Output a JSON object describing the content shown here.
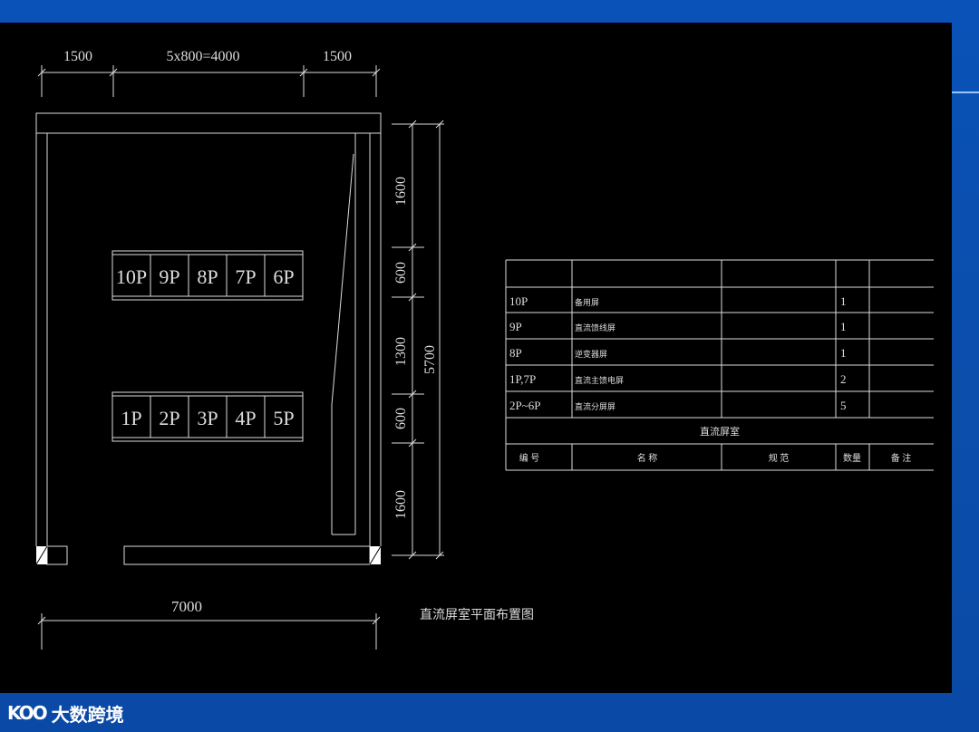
{
  "drawing": {
    "top_dims": [
      "1500",
      "5x800=4000",
      "1500"
    ],
    "right_dims": [
      "1600",
      "600",
      "1300",
      "600",
      "1600"
    ],
    "total_height": "5700",
    "total_width": "7000",
    "row_top": [
      "10P",
      "9P",
      "8P",
      "7P",
      "6P"
    ],
    "row_bottom": [
      "1P",
      "2P",
      "3P",
      "4P",
      "5P"
    ],
    "caption": "直流屏室平面布置图"
  },
  "table": {
    "rows": [
      {
        "id": "10P",
        "name": "备用屏",
        "spec": "",
        "qty": "1",
        "note": ""
      },
      {
        "id": "9P",
        "name": "直流馈线屏",
        "spec": "",
        "qty": "1",
        "note": ""
      },
      {
        "id": "8P",
        "name": "逆变器屏",
        "spec": "",
        "qty": "1",
        "note": ""
      },
      {
        "id": "1P,7P",
        "name": "直流主馈电屏",
        "spec": "",
        "qty": "2",
        "note": ""
      },
      {
        "id": "2P~6P",
        "name": "直流分屏屏",
        "spec": "",
        "qty": "5",
        "note": ""
      }
    ],
    "title": "直流屏室",
    "headers": [
      "编 号",
      "名 称",
      "规 范",
      "数量",
      "备 注"
    ]
  },
  "branding": {
    "logo_mark": "KOO",
    "logo_name": "大数跨境"
  },
  "colors": {
    "slide_blue": "#0a52b8",
    "canvas": "#000000",
    "line": "#dcdcdc"
  }
}
